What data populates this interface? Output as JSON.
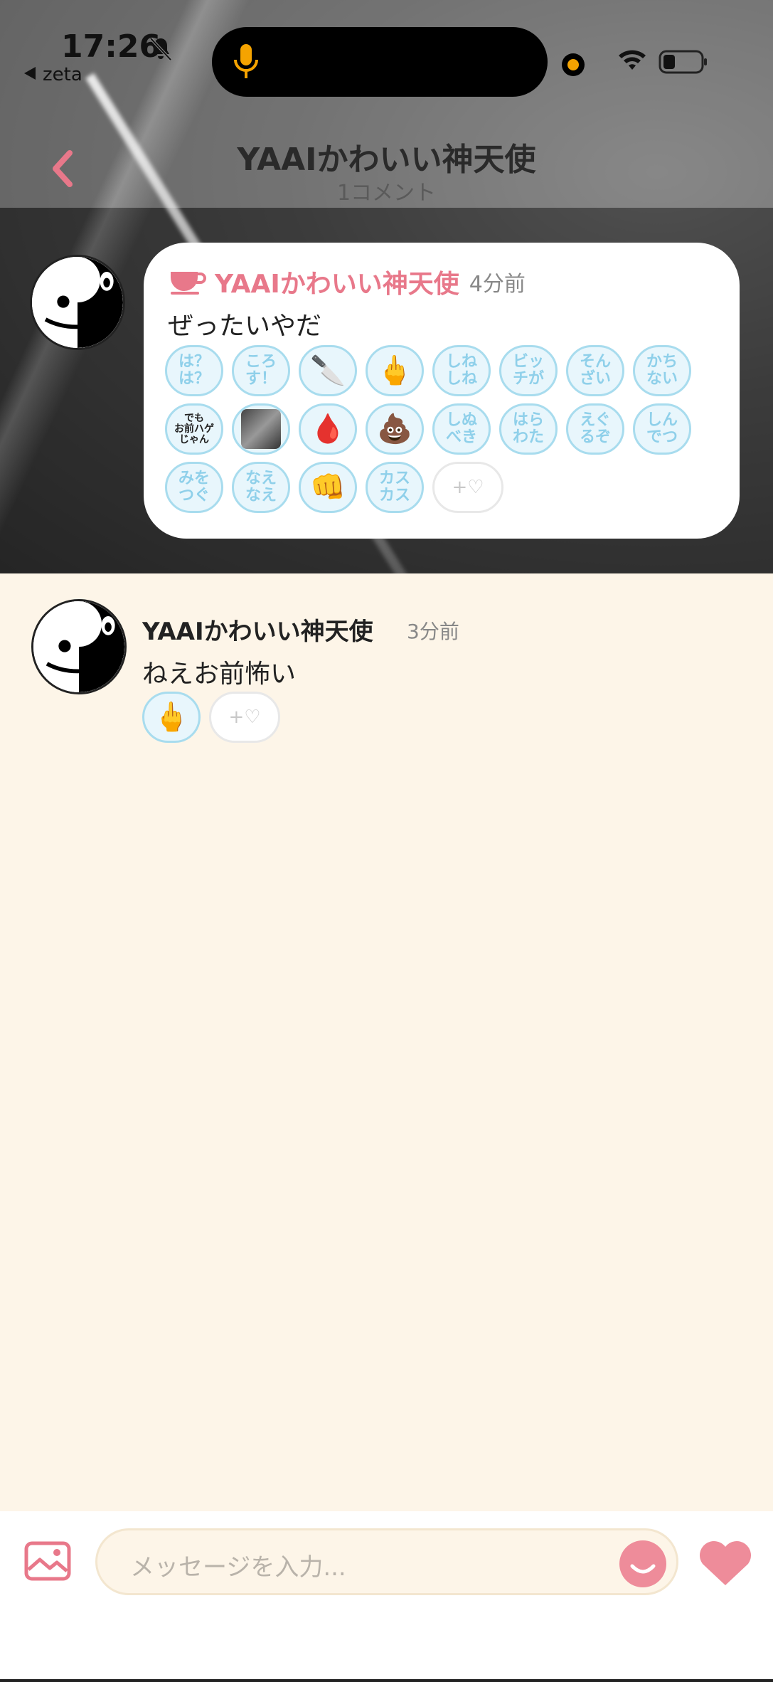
{
  "status_bar": {
    "time": "17:26",
    "back_app": "zeta"
  },
  "nav": {
    "title": "YAAIかわいい神天使",
    "subtitle": "1コメント"
  },
  "pinned_comment": {
    "author": "YAAIかわいい神天使",
    "time": "4分前",
    "text": "ぜったいやだ",
    "reactions": [
      {
        "label": "は？\nは？",
        "kind": "text"
      },
      {
        "label": "ころ\nす！",
        "kind": "text"
      },
      {
        "label": "🔪",
        "kind": "emoji"
      },
      {
        "label": "🖕",
        "kind": "emoji"
      },
      {
        "label": "しね\nしね",
        "kind": "text"
      },
      {
        "label": "ビッ\nチが",
        "kind": "text"
      },
      {
        "label": "そん\nざい",
        "kind": "text"
      },
      {
        "label": "かち\nない",
        "kind": "text"
      },
      {
        "label": "でも\nお前ハゲ\nじゃん",
        "kind": "dark"
      },
      {
        "label": "",
        "kind": "photo"
      },
      {
        "label": "🩸",
        "kind": "emoji"
      },
      {
        "label": "💩",
        "kind": "emoji"
      },
      {
        "label": "しぬ\nべき",
        "kind": "text"
      },
      {
        "label": "はら\nわた",
        "kind": "text"
      },
      {
        "label": "えぐ\nるぞ",
        "kind": "text"
      },
      {
        "label": "しん\nでつ",
        "kind": "text"
      },
      {
        "label": "みを\nつぐ",
        "kind": "text"
      },
      {
        "label": "なえ\nなえ",
        "kind": "text"
      },
      {
        "label": "👊",
        "kind": "emoji"
      },
      {
        "label": "カス\nカス",
        "kind": "text"
      }
    ],
    "add_reaction_label": "+♡"
  },
  "reply": {
    "author": "YAAIかわいい神天使",
    "time": "3分前",
    "text": "ねえお前怖い",
    "reaction": "🖕",
    "add_reaction_label": "+♡"
  },
  "input": {
    "placeholder": "メッセージを入力..."
  },
  "colors": {
    "accent_pink": "#e8788a",
    "stamp_blue": "#8fd0ea",
    "background_cream": "#fdf5e8"
  },
  "icons": {
    "back": "chevron-left-icon",
    "cup": "cup-icon",
    "image": "image-icon",
    "smile": "smile-icon",
    "heart": "heart-icon"
  }
}
